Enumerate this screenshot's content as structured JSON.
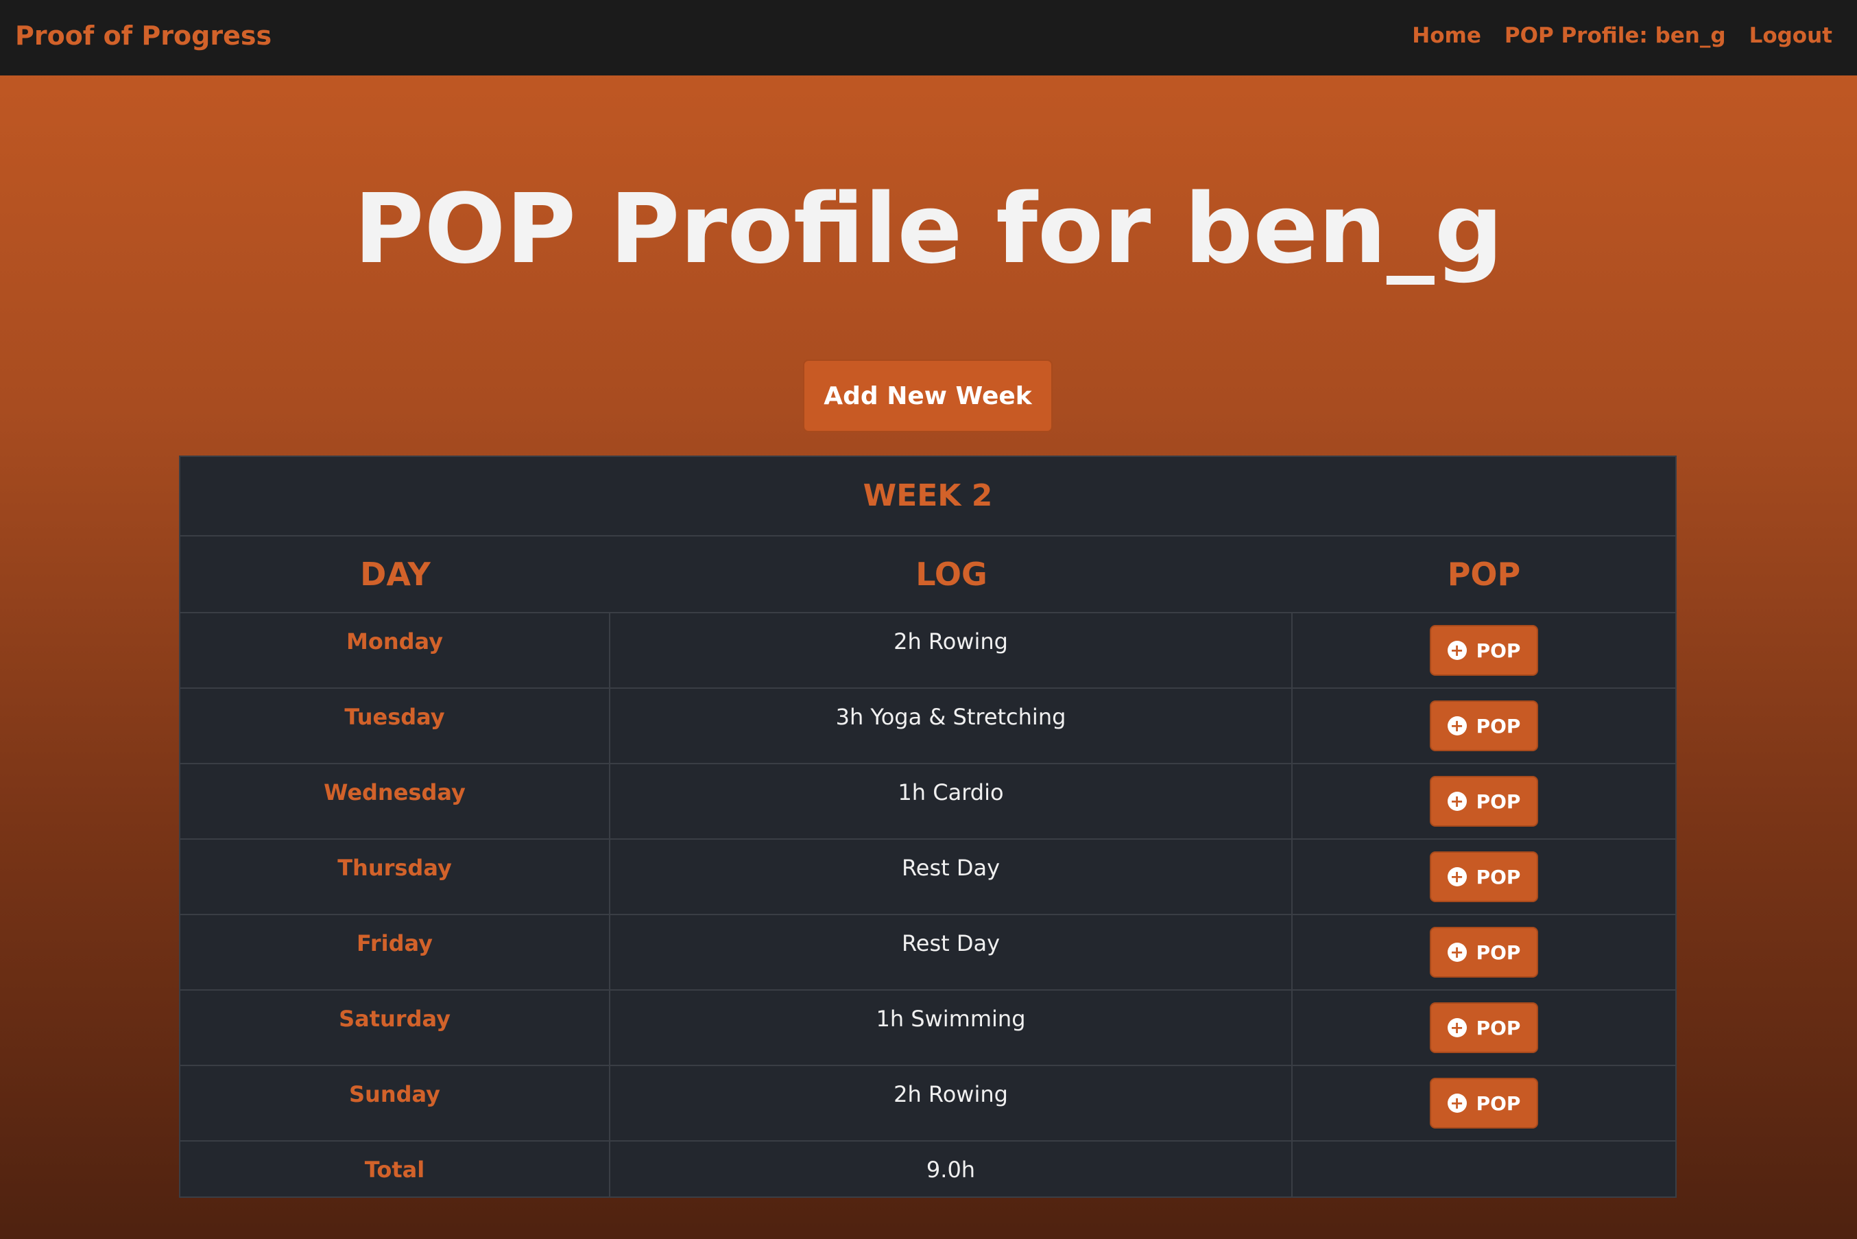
{
  "navbar": {
    "brand": "Proof of Progress",
    "links": [
      "Home",
      "POP Profile: ben_g",
      "Logout"
    ]
  },
  "page": {
    "title": "POP Profile for ben_g",
    "add_week_label": "Add New Week"
  },
  "week": {
    "title": "WEEK 2",
    "headers": {
      "day": "DAY",
      "log": "LOG",
      "pop": "POP"
    },
    "rows": [
      {
        "day": "Monday",
        "log": "2h Rowing",
        "pop_label": "POP"
      },
      {
        "day": "Tuesday",
        "log": "3h Yoga & Stretching",
        "pop_label": "POP"
      },
      {
        "day": "Wednesday",
        "log": "1h Cardio",
        "pop_label": "POP"
      },
      {
        "day": "Thursday",
        "log": "Rest Day",
        "pop_label": "POP"
      },
      {
        "day": "Friday",
        "log": "Rest Day",
        "pop_label": "POP"
      },
      {
        "day": "Saturday",
        "log": "1h Swimming",
        "pop_label": "POP"
      },
      {
        "day": "Sunday",
        "log": "2h Rowing",
        "pop_label": "POP"
      }
    ],
    "total": {
      "label": "Total",
      "value": "9.0h"
    }
  },
  "colors": {
    "accent": "#d2622a",
    "button": "#c85a24",
    "navbar_bg": "#1b1b1b",
    "table_bg": "#23272e"
  },
  "icons": {
    "pop_button_icon": "plus-circle-icon"
  }
}
